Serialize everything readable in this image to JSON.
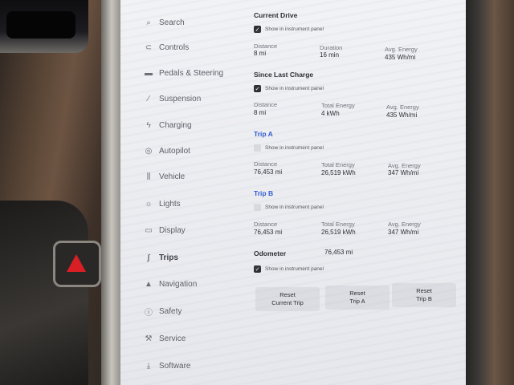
{
  "sidebar": {
    "items": [
      {
        "label": "Search",
        "icon": "search-icon",
        "glyph": "⌕"
      },
      {
        "label": "Controls",
        "icon": "toggle-icon",
        "glyph": "⊂"
      },
      {
        "label": "Pedals & Steering",
        "icon": "car-icon",
        "glyph": "▬"
      },
      {
        "label": "Suspension",
        "icon": "suspension-icon",
        "glyph": "⁄"
      },
      {
        "label": "Charging",
        "icon": "bolt-icon",
        "glyph": "ϟ"
      },
      {
        "label": "Autopilot",
        "icon": "steering-wheel-icon",
        "glyph": "◎"
      },
      {
        "label": "Vehicle",
        "icon": "sliders-icon",
        "glyph": "⫼"
      },
      {
        "label": "Lights",
        "icon": "lightbulb-icon",
        "glyph": "☼"
      },
      {
        "label": "Display",
        "icon": "display-icon",
        "glyph": "▭"
      },
      {
        "label": "Trips",
        "icon": "trips-icon",
        "glyph": "∫"
      },
      {
        "label": "Navigation",
        "icon": "navigation-icon",
        "glyph": "▲"
      },
      {
        "label": "Safety",
        "icon": "safety-icon",
        "glyph": "ⓘ"
      },
      {
        "label": "Service",
        "icon": "wrench-icon",
        "glyph": "⚒"
      },
      {
        "label": "Software",
        "icon": "download-icon",
        "glyph": "⤓"
      }
    ],
    "active": "Trips"
  },
  "current_drive": {
    "title": "Current Drive",
    "show_label": "Show in instrument panel",
    "checked": true,
    "distance_label": "Distance",
    "distance_value": "8 mi",
    "duration_label": "Duration",
    "duration_value": "16 min",
    "energy_label": "Avg. Energy",
    "energy_value": "435 Wh/mi"
  },
  "since_last_charge": {
    "title": "Since Last Charge",
    "show_label": "Show in instrument panel",
    "checked": true,
    "distance_label": "Distance",
    "distance_value": "8 mi",
    "total_label": "Total Energy",
    "total_value": "4 kWh",
    "energy_label": "Avg. Energy",
    "energy_value": "435 Wh/mi"
  },
  "trip_a": {
    "title": "Trip A",
    "show_label": "Show in instrument panel",
    "checked": false,
    "distance_label": "Distance",
    "distance_value": "76,453 mi",
    "total_label": "Total Energy",
    "total_value": "26,519 kWh",
    "energy_label": "Avg. Energy",
    "energy_value": "347 Wh/mi"
  },
  "trip_b": {
    "title": "Trip B",
    "show_label": "Show in instrument panel",
    "checked": false,
    "distance_label": "Distance",
    "distance_value": "76,453 mi",
    "total_label": "Total Energy",
    "total_value": "26,519 kWh",
    "energy_label": "Avg. Energy",
    "energy_value": "347 Wh/mi"
  },
  "odometer": {
    "label": "Odometer",
    "value": "76,453 mi",
    "show_label": "Show in instrument panel",
    "checked": true
  },
  "buttons": {
    "reset_current_line1": "Reset",
    "reset_current_line2": "Current Trip",
    "reset_a_line1": "Reset",
    "reset_a_line2": "Trip A",
    "reset_b_line1": "Reset",
    "reset_b_line2": "Trip B"
  },
  "colors": {
    "accent_blue": "#2f5bd1",
    "hazard_red": "#d81f26"
  }
}
